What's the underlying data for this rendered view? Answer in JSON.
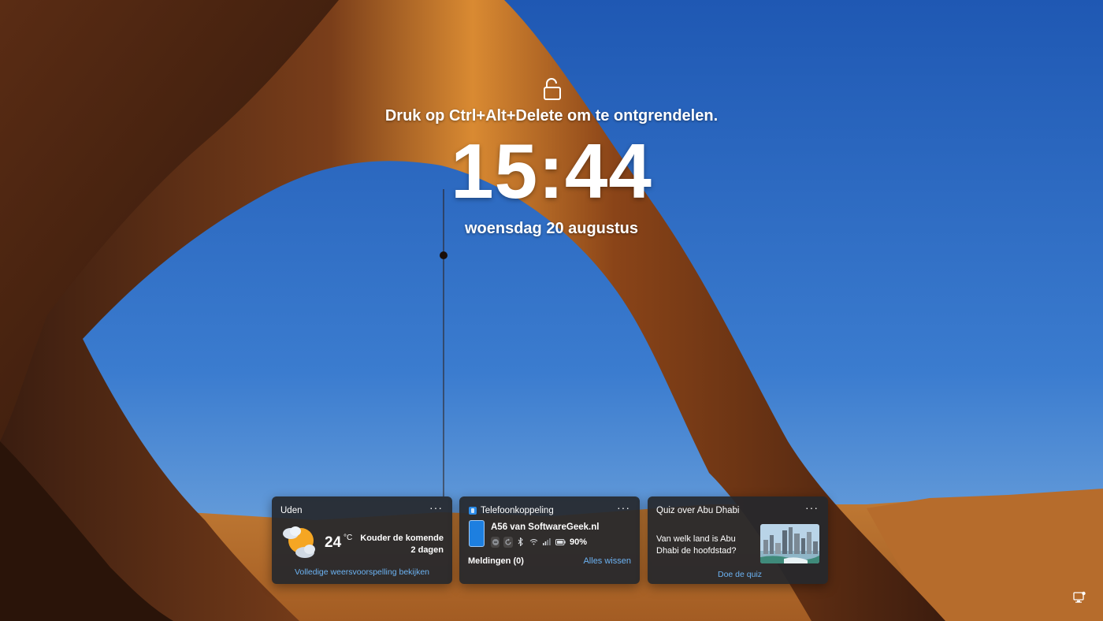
{
  "lock_screen": {
    "hint": "Druk op Ctrl+Alt+Delete om te ontgrendelen.",
    "time": "15:44",
    "date": "woensdag 20 augustus",
    "lock_icon": "unlock-icon"
  },
  "widgets": {
    "weather": {
      "title": "Uden",
      "more": "···",
      "temperature": "24",
      "unit": "°C",
      "forecast_line1": "Kouder de komende",
      "forecast_line2": "2 dagen",
      "link": "Volledige weersvoorspelling bekijken",
      "icon": "partly-cloudy-icon"
    },
    "phone": {
      "title": "Telefoonkoppeling",
      "more": "···",
      "device": "A56 van SoftwareGeek.nl",
      "battery": "90%",
      "notifications": "Meldingen (0)",
      "clear": "Alles wissen",
      "icons": [
        "do-not-disturb-icon",
        "sync-icon",
        "bluetooth-icon",
        "wifi-icon",
        "signal-icon",
        "battery-icon"
      ]
    },
    "quiz": {
      "title": "Quiz over Abu Dhabi",
      "more": "···",
      "question": "Van welk land is Abu Dhabi de hoofdstad?",
      "link": "Doe de quiz",
      "image": "abu-dhabi-skyline-image"
    }
  },
  "system_tray": {
    "icon": "network-icon"
  },
  "colors": {
    "sky": "#2f67c0",
    "rock": "#c9742a",
    "card_bg": "#26282c",
    "link": "#6cb3f3"
  }
}
